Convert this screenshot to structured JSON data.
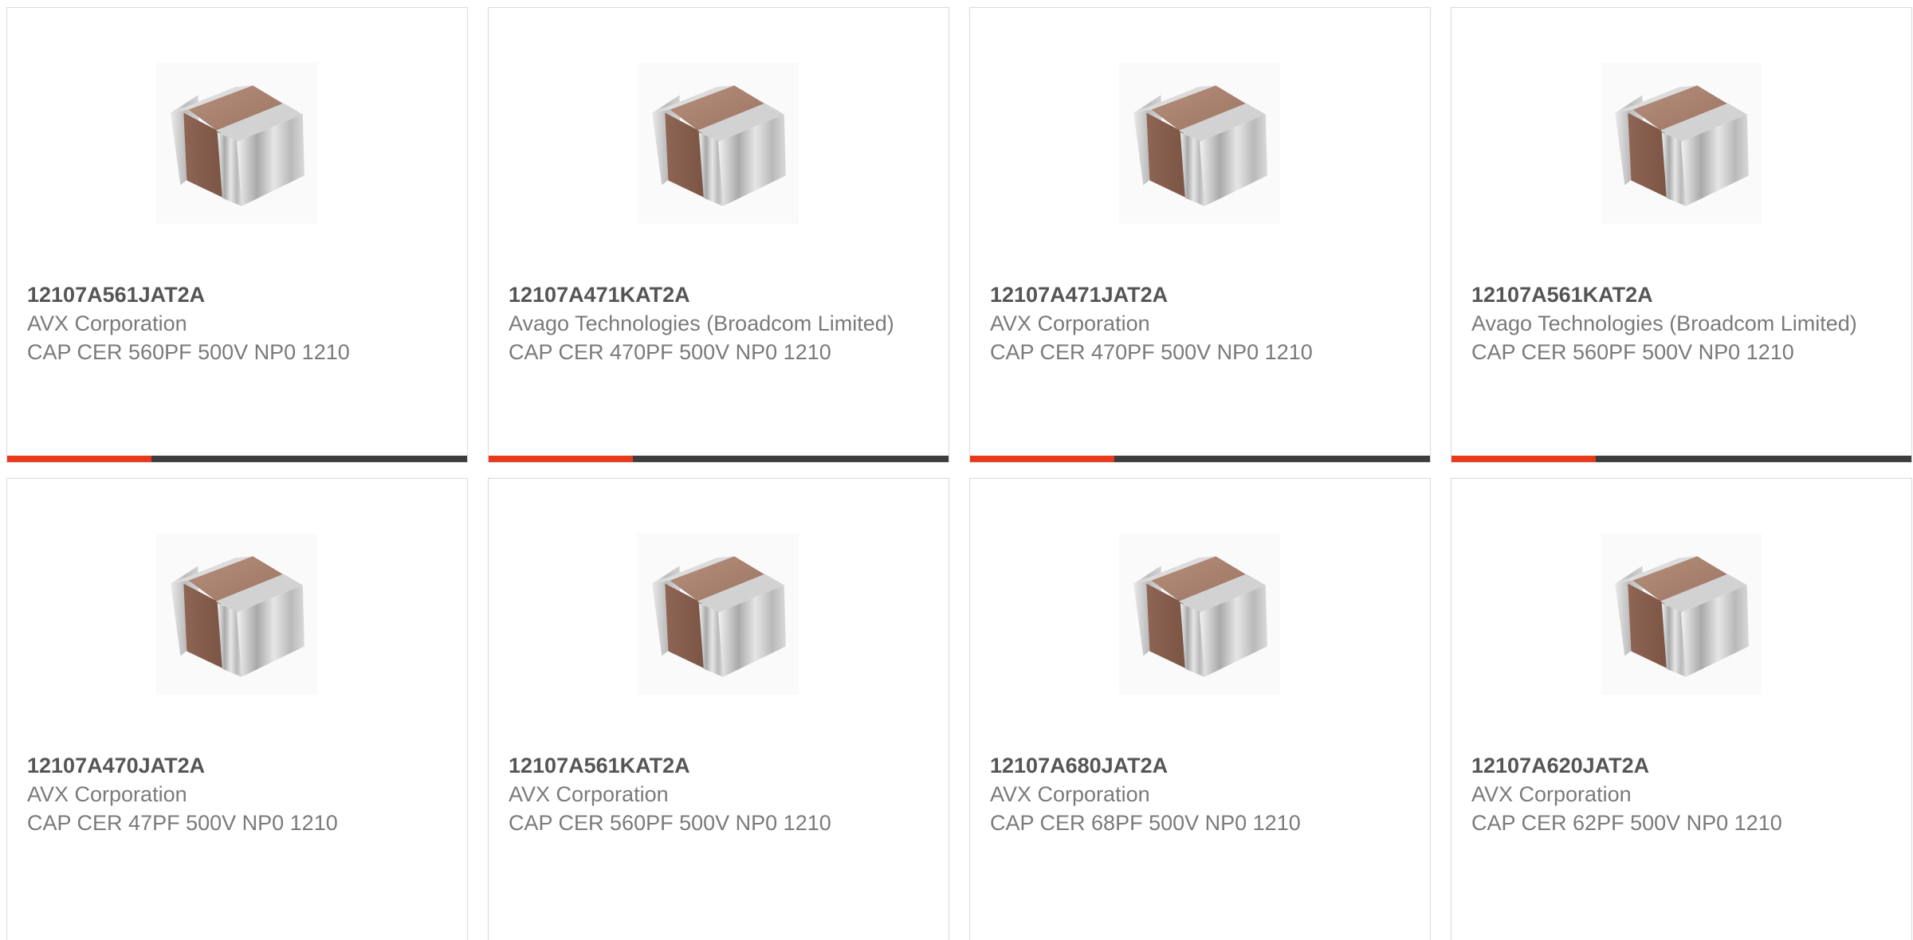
{
  "products": [
    {
      "part": "12107A561JAT2A",
      "manufacturer": "AVX Corporation",
      "description": "CAP CER 560PF 500V NP0 1210"
    },
    {
      "part": "12107A471KAT2A",
      "manufacturer": "Avago Technologies (Broadcom Limited)",
      "description": "CAP CER 470PF 500V NP0 1210"
    },
    {
      "part": "12107A471JAT2A",
      "manufacturer": "AVX Corporation",
      "description": "CAP CER 470PF 500V NP0 1210"
    },
    {
      "part": "12107A561KAT2A",
      "manufacturer": "Avago Technologies (Broadcom Limited)",
      "description": "CAP CER 560PF 500V NP0 1210"
    },
    {
      "part": "12107A470JAT2A",
      "manufacturer": "AVX Corporation",
      "description": "CAP CER 47PF 500V NP0 1210"
    },
    {
      "part": "12107A561KAT2A",
      "manufacturer": "AVX Corporation",
      "description": "CAP CER 560PF 500V NP0 1210"
    },
    {
      "part": "12107A680JAT2A",
      "manufacturer": "AVX Corporation",
      "description": "CAP CER 68PF 500V NP0 1210"
    },
    {
      "part": "12107A620JAT2A",
      "manufacturer": "AVX Corporation",
      "description": "CAP CER 62PF 500V NP0 1210"
    }
  ],
  "product_image_icon": "ceramic-capacitor-chip",
  "colors": {
    "accent": "#e8391c",
    "bar": "#3d3d3d",
    "part_text": "#555555",
    "meta_text": "#7a7a7a",
    "border": "#d9d9d9"
  }
}
